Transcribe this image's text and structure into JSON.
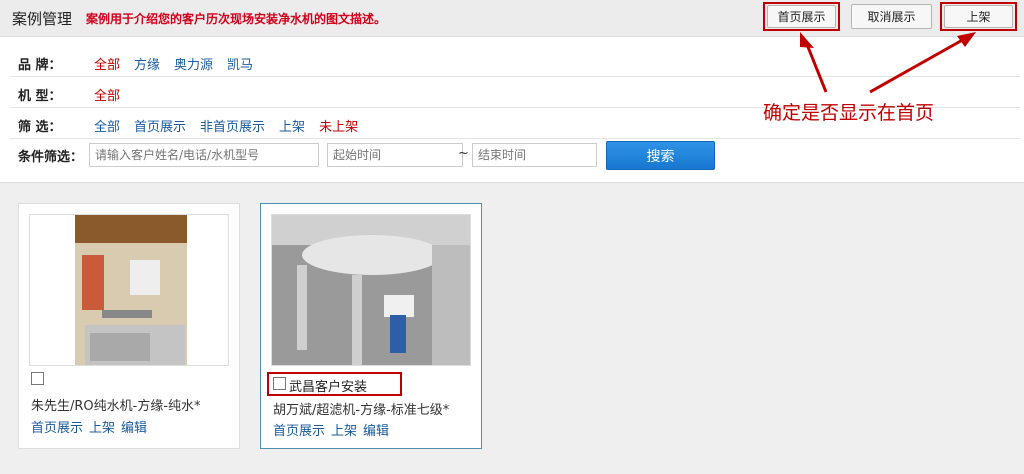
{
  "header": {
    "title": "案例管理",
    "description": "案例用于介绍您的客户历次现场安装净水机的图文描述。",
    "buttons": {
      "show_home": "首页展示",
      "cancel_show": "取消展示",
      "shelve": "上架"
    }
  },
  "filters": {
    "brand": {
      "label": "品 牌：",
      "options": [
        "全部",
        "方缘",
        "奥力源",
        "凯马"
      ],
      "active": "全部"
    },
    "model": {
      "label": "机 型：",
      "options": [
        "全部"
      ],
      "active": "全部"
    },
    "screen": {
      "label": "筛 选：",
      "options": [
        "全部",
        "首页展示",
        "非首页展示",
        "上架",
        "未上架"
      ],
      "active": "未上架"
    },
    "condition": {
      "label": "条件筛选：",
      "keyword_placeholder": "请输入客户姓名/电话/水机型号",
      "start_placeholder": "起始时间",
      "separator": "~",
      "end_placeholder": "结束时间",
      "search_label": "搜索"
    }
  },
  "cases": [
    {
      "title": "",
      "caption": "朱先生/RO纯水机-方缘-纯水*",
      "links": [
        "首页展示",
        "上架",
        "编辑"
      ]
    },
    {
      "title": "武昌客户安装",
      "caption": "胡万斌/超滤机-方缘-标准七级*",
      "links": [
        "首页展示",
        "上架",
        "编辑"
      ]
    }
  ],
  "annotation": "确定是否显示在首页",
  "colors": {
    "accent_red": "#c00000",
    "link_blue": "#1a5b9e",
    "search_button": "#1877d1"
  }
}
